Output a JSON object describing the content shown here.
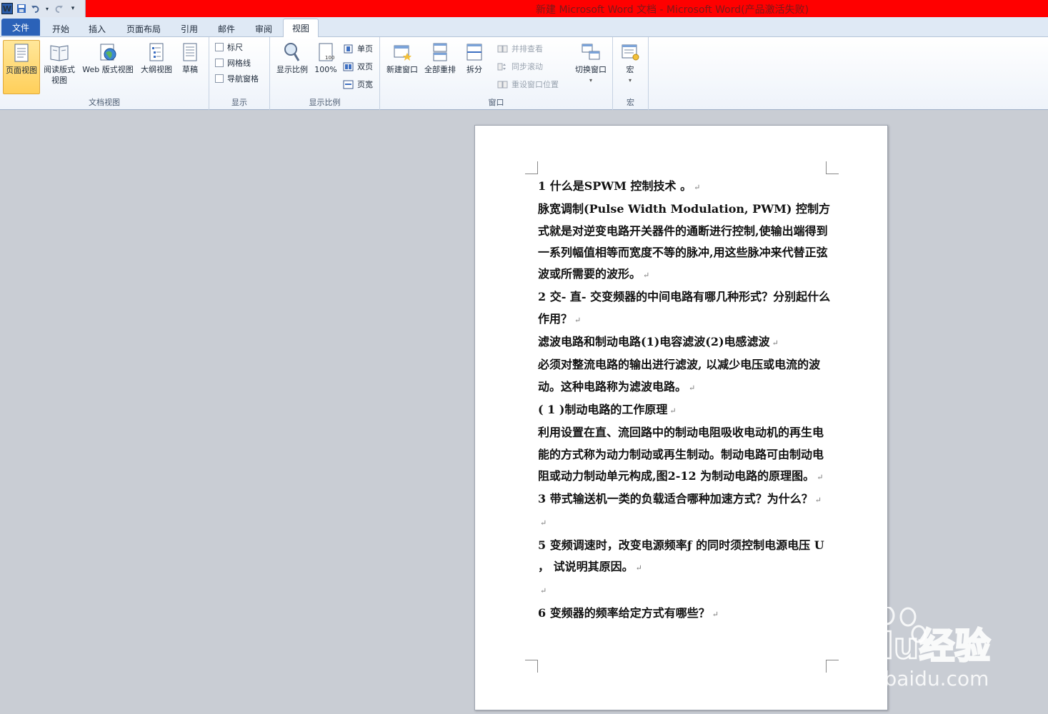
{
  "window": {
    "title": "新建 Microsoft Word 文档 - Microsoft Word(产品激活失败)",
    "accent": "#ff0000"
  },
  "qat": {
    "logo": "W",
    "icons": [
      "word-logo",
      "save-icon",
      "undo-icon",
      "redo-icon",
      "customize-icon"
    ]
  },
  "tabs": {
    "file": "文件",
    "items": [
      "开始",
      "插入",
      "页面布局",
      "引用",
      "邮件",
      "审阅",
      "视图"
    ],
    "active": "视图"
  },
  "ribbon": {
    "doc_views": {
      "label": "文档视图",
      "print_layout": "页面视图",
      "reading": "阅读版式\n视图",
      "web": "Web 版式视图",
      "outline": "大纲视图",
      "draft": "草稿"
    },
    "show": {
      "label": "显示",
      "ruler": "标尺",
      "gridlines": "网格线",
      "nav_pane": "导航窗格"
    },
    "zoom": {
      "label": "显示比例",
      "zoom": "显示比例",
      "hundred": "100%",
      "one_page": "单页",
      "two_pages": "双页",
      "page_width": "页宽"
    },
    "window": {
      "label": "窗口",
      "new_window": "新建窗口",
      "arrange_all": "全部重排",
      "split": "拆分",
      "side_by_side": "并排查看",
      "sync_scroll": "同步滚动",
      "reset_position": "重设窗口位置",
      "switch_windows": "切换窗口"
    },
    "macros": {
      "label": "宏",
      "macros": "宏"
    }
  },
  "document": {
    "paragraphs": [
      "1 什么是SPWM 控制技术 。",
      "脉宽调制(Pulse Width Modulation, PWM) 控制方式就是对逆变电路开关器件的通断进行控制,使输出端得到一系列幅值相等而宽度不等的脉冲,用这些脉冲来代替正弦波或所需要的波形。",
      "2 交- 直- 交变频器的中间电路有哪几种形式？分别起什么作用？",
      "滤波电路和制动电路(1)电容滤波(2)电感滤波",
      "必须对整流电路的输出进行滤波, 以减少电压或电流的波动。这种电路称为滤波电路。",
      "( 1 )制动电路的工作原理",
      "利用设置在直、流回路中的制动电阻吸收电动机的再生电能的方式称为动力制动或再生制动。制动电路可由制动电阻或动力制动单元构成,图2-12 为制动电路的原理图。",
      "3 带式输送机一类的负载适合哪种加速方式？为什么？",
      "",
      "5 变频调速时，改变电源频率ƒ 的同时须控制电源电压 U ， 试说明其原因。",
      "",
      "6 变频器的频率给定方式有哪些？"
    ],
    "paragraph_mark": "↵"
  },
  "watermark": {
    "brand": "Baidu经验",
    "url": "jingyan.baidu.com"
  }
}
